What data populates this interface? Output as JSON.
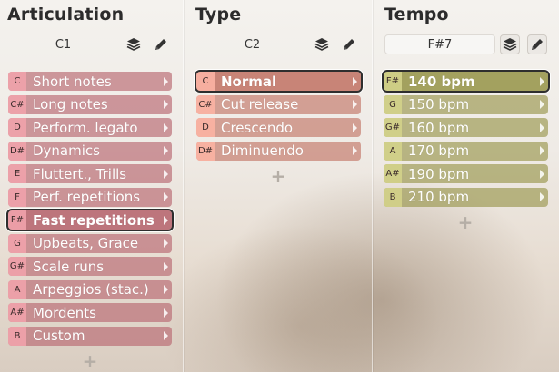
{
  "columns": [
    {
      "title": "Articulation",
      "key_value": "C1",
      "accent": "#b96b74",
      "items": [
        {
          "note": "C",
          "label": "Short notes",
          "selected": false
        },
        {
          "note": "C#",
          "label": "Long notes",
          "selected": false
        },
        {
          "note": "D",
          "label": "Perform. legato",
          "selected": false
        },
        {
          "note": "D#",
          "label": "Dynamics",
          "selected": false
        },
        {
          "note": "E",
          "label": "Fluttert., Trills",
          "selected": false
        },
        {
          "note": "F",
          "label": "Perf. repetitions",
          "selected": false
        },
        {
          "note": "F#",
          "label": "Fast repetitions",
          "selected": true
        },
        {
          "note": "G",
          "label": "Upbeats, Grace",
          "selected": false
        },
        {
          "note": "G#",
          "label": "Scale runs",
          "selected": false
        },
        {
          "note": "A",
          "label": "Arpeggios (stac.)",
          "selected": false
        },
        {
          "note": "A#",
          "label": "Mordents",
          "selected": false
        },
        {
          "note": "B",
          "label": "Custom",
          "selected": false
        }
      ],
      "add_label": "+"
    },
    {
      "title": "Type",
      "key_value": "C2",
      "accent": "#c47b6c",
      "items": [
        {
          "note": "C",
          "label": "Normal",
          "selected": true
        },
        {
          "note": "C#",
          "label": "Cut release",
          "selected": false
        },
        {
          "note": "D",
          "label": "Crescendo",
          "selected": false
        },
        {
          "note": "D#",
          "label": "Diminuendo",
          "selected": false
        }
      ],
      "add_label": "+"
    },
    {
      "title": "Tempo",
      "key_value": "F#7",
      "accent": "#9c9a52",
      "items": [
        {
          "note": "F#",
          "label": "140 bpm",
          "selected": true
        },
        {
          "note": "G",
          "label": "150 bpm",
          "selected": false
        },
        {
          "note": "G#",
          "label": "160 bpm",
          "selected": false
        },
        {
          "note": "A",
          "label": "170 bpm",
          "selected": false
        },
        {
          "note": "A#",
          "label": "190 bpm",
          "selected": false
        },
        {
          "note": "B",
          "label": "210 bpm",
          "selected": false
        }
      ],
      "add_label": "+"
    }
  ],
  "icons": {
    "layers": "layers-icon",
    "edit": "pencil-icon"
  }
}
